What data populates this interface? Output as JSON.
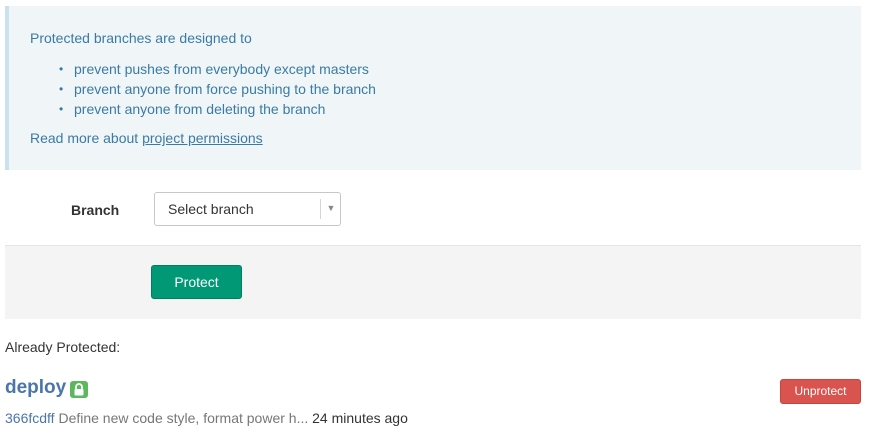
{
  "info": {
    "intro": "Protected branches are designed to",
    "items": [
      "prevent pushes from everybody except masters",
      "prevent anyone from force pushing to the branch",
      "prevent anyone from deleting the branch"
    ],
    "read_more_prefix": "Read more about ",
    "read_more_link": "project permissions",
    "bullet": "•"
  },
  "form": {
    "branch_label": "Branch",
    "branch_select_value": "Select branch",
    "select_arrow": "▼",
    "protect_button": "Protect"
  },
  "protected": {
    "heading": "Already Protected:",
    "branches": [
      {
        "name": "deploy",
        "icon": "lock-icon",
        "commit_sha": "366fcdff",
        "commit_message": "Define new code style, format power h...",
        "commit_time": "24 minutes ago",
        "unprotect_label": "Unprotect"
      }
    ]
  },
  "colors": {
    "info_text": "#3a7ba4",
    "info_bg": "#f0f5f8",
    "protect_button": "#019875",
    "unprotect_button": "#d9534f",
    "branch_link": "#4a76a8",
    "lock_badge": "#5cb85c"
  }
}
